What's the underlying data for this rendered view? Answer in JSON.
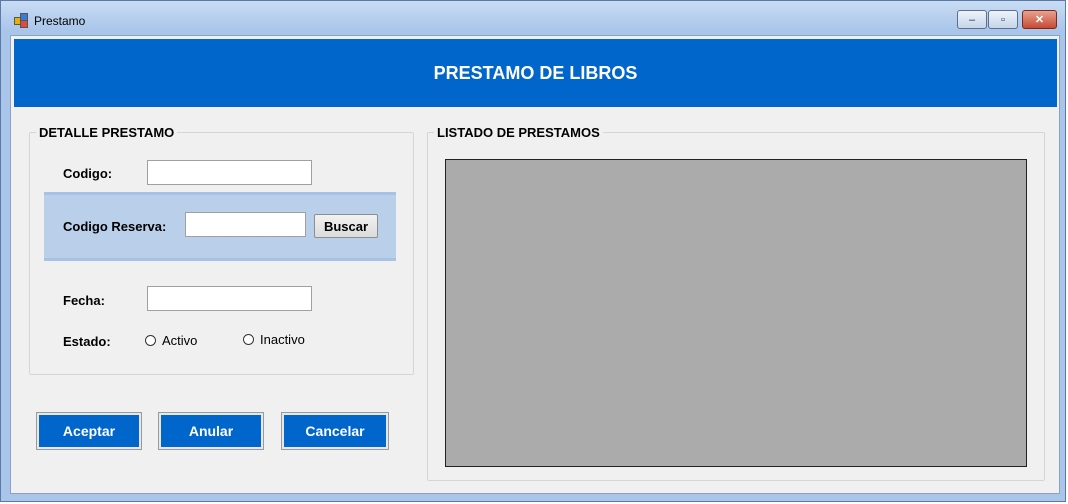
{
  "window": {
    "title": "Prestamo",
    "minimize_glyph": "–",
    "maximize_glyph": "▫",
    "close_glyph": "✕"
  },
  "header": {
    "title": "PRESTAMO DE LIBROS"
  },
  "detalle": {
    "group_title": "DETALLE PRESTAMO",
    "codigo_label": "Codigo:",
    "codigo_value": "",
    "reserva_label": "Codigo Reserva:",
    "reserva_value": "",
    "buscar_label": "Buscar",
    "fecha_label": "Fecha:",
    "fecha_value": "",
    "estado_label": "Estado:",
    "estado_options": [
      "Activo",
      "Inactivo"
    ]
  },
  "actions": {
    "aceptar": "Aceptar",
    "anular": "Anular",
    "cancelar": "Cancelar"
  },
  "listado": {
    "group_title": "LISTADO DE PRESTAMOS"
  },
  "colors": {
    "accent": "#0066cc",
    "panel": "#b9cfea",
    "grid": "#ababab"
  }
}
